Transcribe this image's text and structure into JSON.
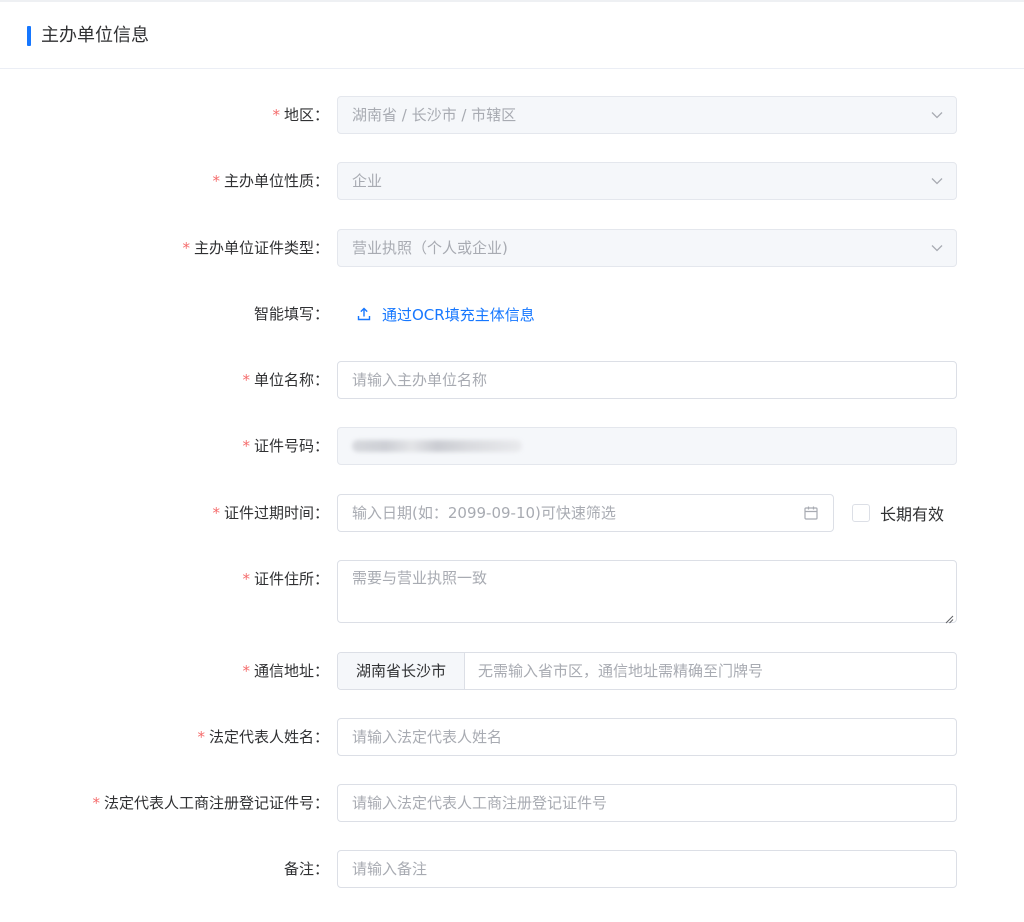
{
  "section": {
    "title": "主办单位信息"
  },
  "required_mark": "*",
  "colon": "：",
  "fields": {
    "region": {
      "label": "地区",
      "value": "湖南省 / 长沙市 / 市辖区"
    },
    "nature": {
      "label": "主办单位性质",
      "value": "企业"
    },
    "cert_type": {
      "label": "主办单位证件类型",
      "value": "营业执照（个人或企业)"
    },
    "smart_fill": {
      "label": "智能填写",
      "link_text": "通过OCR填充主体信息"
    },
    "unit_name": {
      "label": "单位名称",
      "placeholder": "请输入主办单位名称"
    },
    "cert_no": {
      "label": "证件号码"
    },
    "cert_expire": {
      "label": "证件过期时间",
      "placeholder": "输入日期(如：2099-09-10)可快速筛选",
      "long_term_label": "长期有效"
    },
    "cert_address": {
      "label": "证件住所",
      "placeholder": "需要与营业执照一致"
    },
    "mail_address": {
      "label": "通信地址",
      "prefix": "湖南省长沙市",
      "placeholder": "无需输入省市区，通信地址需精确至门牌号"
    },
    "legal_name": {
      "label": "法定代表人姓名",
      "placeholder": "请输入法定代表人姓名"
    },
    "legal_reg_no": {
      "label": "法定代表人工商注册登记证件号",
      "placeholder": "请输入法定代表人工商注册登记证件号"
    },
    "remark": {
      "label": "备注",
      "placeholder": "请输入备注"
    }
  },
  "colors": {
    "accent": "#1677ff",
    "required": "#f56c6c",
    "placeholder": "#a8abb2",
    "disabled_bg": "#f5f7fa"
  },
  "icons": {
    "select_arrow": "chevron-down-icon",
    "calendar": "calendar-icon",
    "upload": "upload-icon"
  }
}
